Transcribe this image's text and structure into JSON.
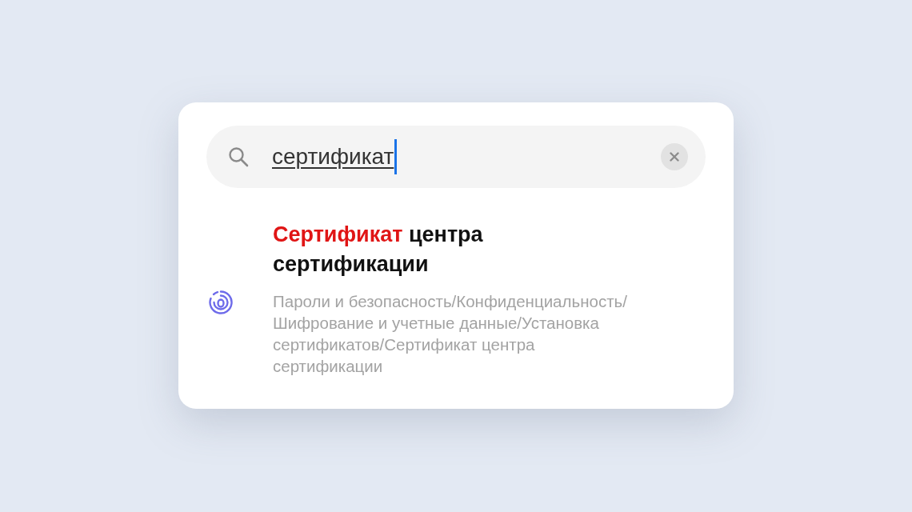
{
  "search": {
    "value": "сертификат",
    "composing": true
  },
  "results": [
    {
      "title": [
        {
          "text": "Сертификат",
          "highlighted": true
        },
        {
          "text": "центра сертификации",
          "highlighted": false
        }
      ],
      "path": "Пароли и безопасность/Конфиденциальность/ Шифрование и учетные данные/Установка сертификатов/Сертификат центра сертификации"
    }
  ]
}
